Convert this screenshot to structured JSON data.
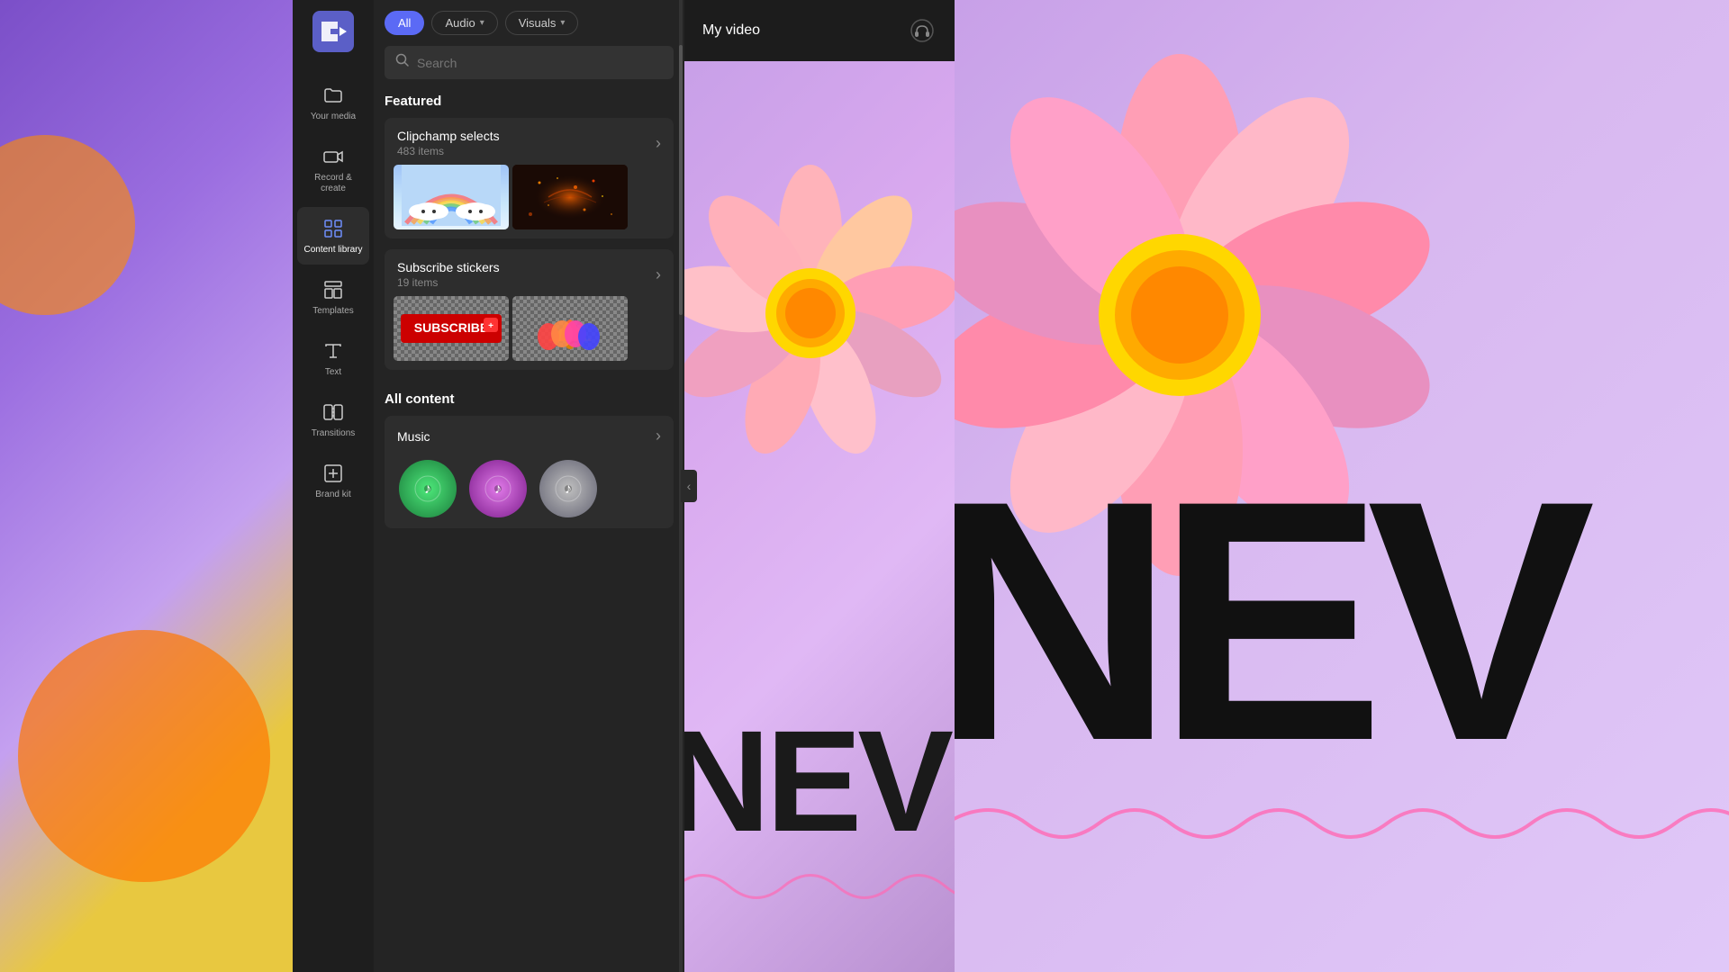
{
  "app": {
    "title": "Clipchamp"
  },
  "sidebar": {
    "items": [
      {
        "id": "your-media",
        "label": "Your media",
        "icon": "folder"
      },
      {
        "id": "record-create",
        "label": "Record &\ncreate",
        "icon": "camera"
      },
      {
        "id": "content-library",
        "label": "Content library",
        "icon": "grid",
        "active": true
      },
      {
        "id": "templates",
        "label": "Templates",
        "icon": "template"
      },
      {
        "id": "text",
        "label": "Text",
        "icon": "text"
      },
      {
        "id": "transitions",
        "label": "Transitions",
        "icon": "transitions"
      },
      {
        "id": "brand-kit",
        "label": "Brand kit",
        "icon": "brand"
      }
    ]
  },
  "filters": {
    "items": [
      {
        "id": "all",
        "label": "All",
        "active": true
      },
      {
        "id": "audio",
        "label": "Audio",
        "hasDropdown": true
      },
      {
        "id": "visuals",
        "label": "Visuals",
        "hasDropdown": true
      }
    ]
  },
  "search": {
    "placeholder": "Search"
  },
  "featured": {
    "title": "Featured",
    "cards": [
      {
        "id": "clipchamp-selects",
        "title": "Clipchamp selects",
        "subtitle": "483 items"
      },
      {
        "id": "subscribe-stickers",
        "title": "Subscribe stickers",
        "subtitle": "19 items"
      }
    ]
  },
  "all_content": {
    "title": "All content",
    "music": {
      "title": "Music",
      "arrow": "›"
    }
  },
  "preview": {
    "title": "My video",
    "text_nev": "NEV"
  },
  "icons": {
    "search": "🔍",
    "arrow_right": "›",
    "chevron_left": "‹",
    "music_note": "♪",
    "headphone": "🎧",
    "folder": "📁",
    "camera": "📷",
    "grid": "⊞",
    "text_t": "T",
    "transitions_x": "✕",
    "brand": "⊡"
  }
}
